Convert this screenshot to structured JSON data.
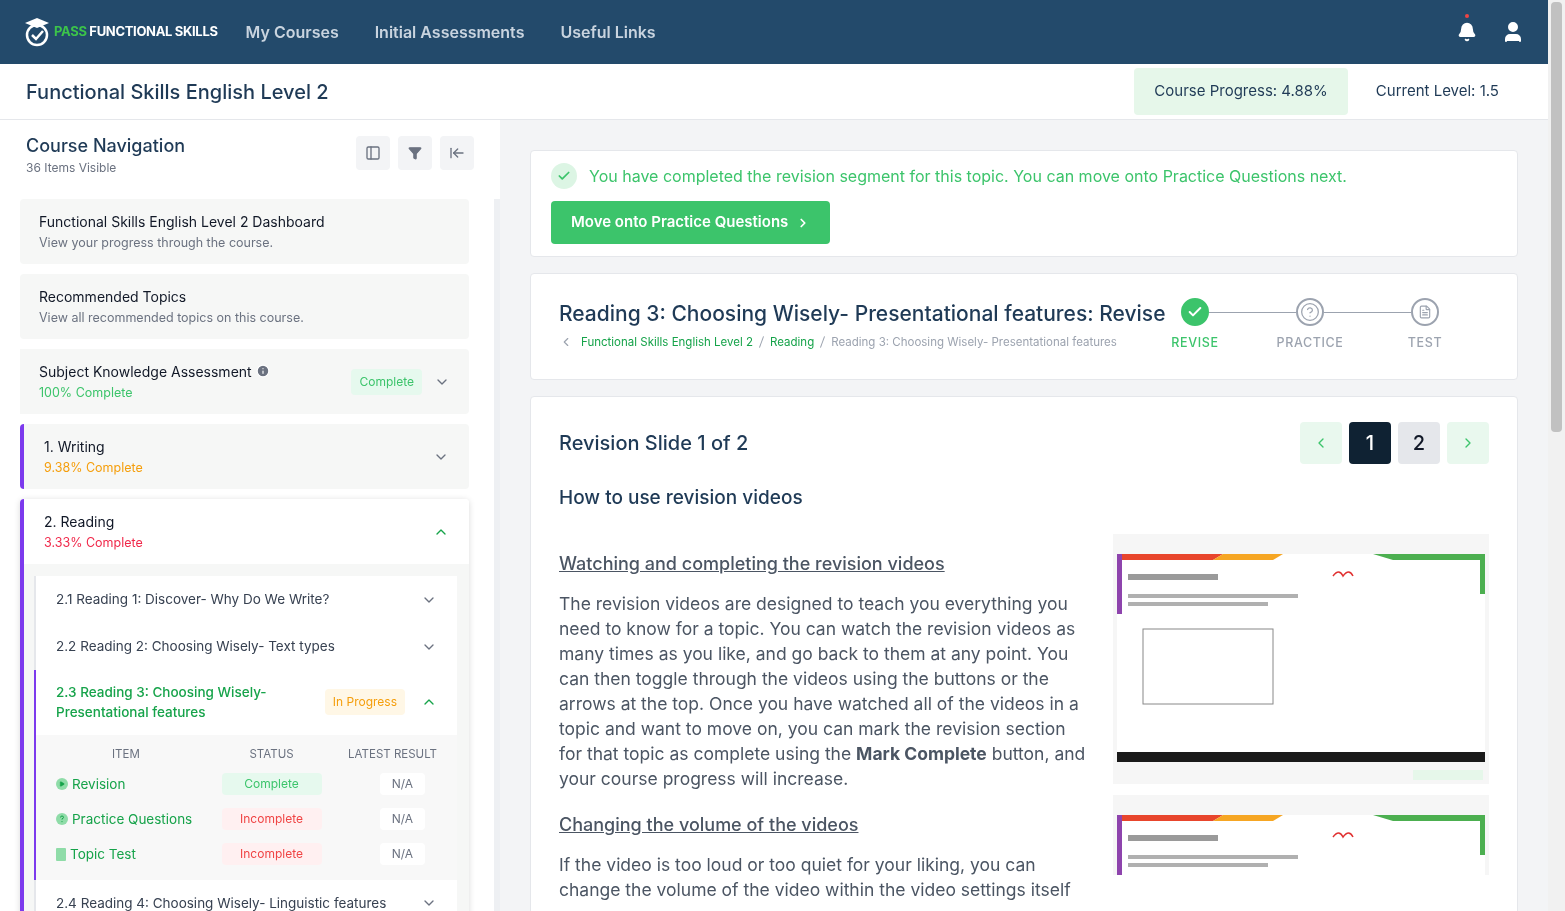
{
  "nav": {
    "logo_accent": "PASS",
    "logo_text": "FUNCTIONAL SKILLS",
    "links": [
      "My Courses",
      "Initial Assessments",
      "Useful Links"
    ],
    "notification_dot": true
  },
  "course": {
    "title": "Functional Skills English Level 2",
    "progress": "Course Progress: 4.88%",
    "level": "Current Level: 1.5"
  },
  "sidebar": {
    "title": "Course Navigation",
    "subtitle": "36 Items Visible",
    "cards": [
      {
        "title": "Functional Skills English Level 2 Dashboard",
        "subtitle": "View your progress through the course."
      },
      {
        "title": "Recommended Topics",
        "subtitle": "View all recommended topics on this course."
      }
    ],
    "sections": [
      {
        "title": "Subject Knowledge Assessment",
        "info": true,
        "progress": "100% Complete",
        "color": "#3cc46b",
        "badge": "Complete",
        "expanded": false
      },
      {
        "title": "1. Writing",
        "progress": "9.38% Complete",
        "color": "#f59e0b",
        "accent": true,
        "expanded": false
      },
      {
        "title": "2. Reading",
        "progress": "3.33% Complete",
        "color": "#f0284a",
        "accent": true,
        "expanded": true,
        "children": [
          {
            "title": "2.1 Reading 1: Discover- Why Do We Write?",
            "expanded": false,
            "selected": false
          },
          {
            "title": "2.2 Reading 2: Choosing Wisely- Text types",
            "expanded": false,
            "selected": false
          },
          {
            "title": "2.3 Reading 3: Choosing Wisely- Presentational features",
            "expanded": true,
            "selected": true,
            "badge": "In Progress",
            "columns": [
              "ITEM",
              "STATUS",
              "LATEST RESULT"
            ],
            "rows": [
              {
                "kind": "video",
                "name": "Revision",
                "status": "Complete",
                "complete": true,
                "result": "N/A"
              },
              {
                "kind": "question",
                "name": "Practice Questions",
                "status": "Incomplete",
                "complete": false,
                "result": "N/A"
              },
              {
                "kind": "test",
                "name": "Topic Test",
                "status": "Incomplete",
                "complete": false,
                "result": "N/A"
              }
            ]
          },
          {
            "title": "2.4 Reading 4: Choosing Wisely- Linguistic features",
            "expanded": false,
            "selected": false
          }
        ]
      }
    ]
  },
  "alert": {
    "message": "You have completed the revision segment for this topic. You can move onto Practice Questions next.",
    "button": "Move onto Practice Questions"
  },
  "topic": {
    "title": "Reading 3: Choosing Wisely- Presentational features: Revise",
    "breadcrumb": [
      "Functional Skills English Level 2",
      "Reading",
      "Reading 3: Choosing Wisely- Presentational features"
    ],
    "steps": [
      {
        "kind": "check",
        "label": "REVISE",
        "done": true
      },
      {
        "kind": "question",
        "label": "PRACTICE",
        "done": false
      },
      {
        "kind": "document",
        "label": "TEST",
        "done": false
      }
    ]
  },
  "slide": {
    "title": "Revision Slide 1 of 2",
    "pages": [
      {
        "label": "1",
        "selected": true
      },
      {
        "label": "2",
        "selected": false
      }
    ],
    "heading": "How to use revision videos",
    "sections": [
      {
        "heading": "Watching and completing the revision videos",
        "text": "The revision videos are designed to teach you everything you need to know for a topic. You can watch the revision videos as many times as you like, and go back to them at any point. You can then toggle through the videos using the buttons or the arrows at the top. Once you have watched all of the videos in a topic and want to move on, you can mark the revision section for that topic as complete using the **Mark Complete** button, and your course progress will increase."
      },
      {
        "heading": "Changing the volume of the videos",
        "text": "If the video is too loud or too quiet for your liking, you can change the volume of the video within the video settings itself"
      }
    ]
  }
}
